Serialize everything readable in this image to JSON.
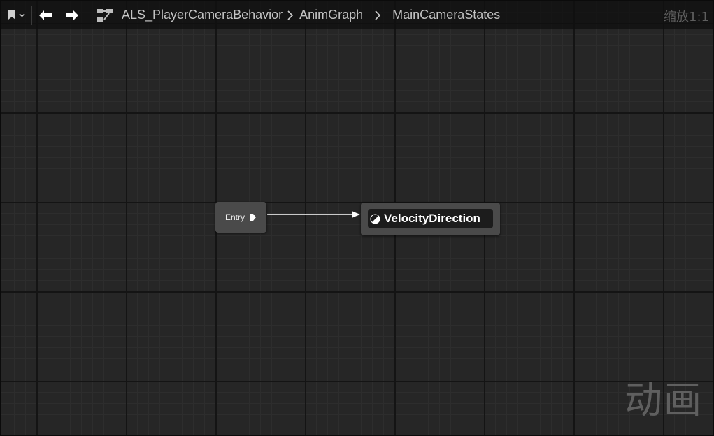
{
  "toolbar": {
    "bookmark_icon": "bookmark-icon",
    "dropdown_icon": "chevron-down-icon",
    "back_icon": "arrow-left-icon",
    "forward_icon": "arrow-right-icon",
    "hierarchy_icon": "graph-hierarchy-icon",
    "breadcrumbs": [
      "ALS_PlayerCameraBehavior",
      "AnimGraph",
      "MainCameraStates"
    ],
    "zoom_label": "缩放1:1"
  },
  "graph": {
    "entry_node": {
      "label": "Entry",
      "pin_icon": "exec-pin-icon"
    },
    "state_node": {
      "label": "VelocityDirection",
      "icon": "state-icon"
    },
    "transition_icon": "arrow-connection-icon"
  },
  "watermark": "动画",
  "colors": {
    "background": "#262626",
    "grid_major": "#141414",
    "grid_minor": "#2d2d2d",
    "node_body": "#4a4a4a",
    "node_title": "#1c1c1c",
    "wire": "#ffffff",
    "watermark": "#5f5f5f"
  }
}
